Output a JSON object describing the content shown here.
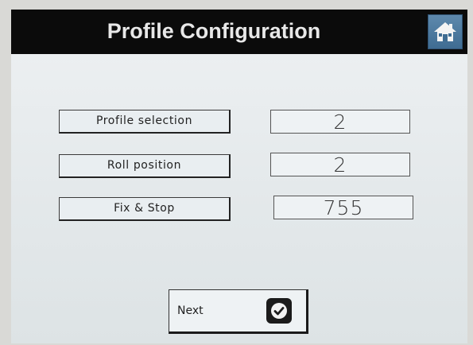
{
  "header": {
    "title": "Profile Configuration",
    "home_icon": "home-icon"
  },
  "fields": [
    {
      "label": "Profile selection",
      "value": "2"
    },
    {
      "label": "Roll position",
      "value": "2"
    },
    {
      "label": "Fix & Stop",
      "value": "755"
    }
  ],
  "footer": {
    "next_label": "Next",
    "next_icon": "checkmark-icon"
  },
  "colors": {
    "header_bg": "#0b0b0b",
    "screen_bg": "#e6eaec",
    "home_button": "#4a7aa0"
  }
}
